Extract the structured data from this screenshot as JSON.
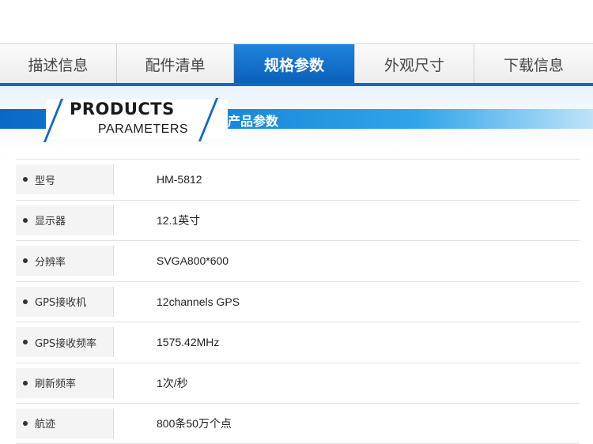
{
  "tabs": [
    {
      "label": "描述信息",
      "active": false
    },
    {
      "label": "配件清单",
      "active": false
    },
    {
      "label": "规格参数",
      "active": true
    },
    {
      "label": "外观尺寸",
      "active": false
    },
    {
      "label": "下载信息",
      "active": false
    }
  ],
  "header": {
    "title_en_line1": "PRODUCTS",
    "title_en_line2": "PARAMETERS",
    "title_cn": "产品参数"
  },
  "specs": [
    {
      "label": "型号",
      "value": "HM-5812"
    },
    {
      "label": "显示器",
      "value": "12.1英寸"
    },
    {
      "label": "分辨率",
      "value": "SVGA800*600"
    },
    {
      "label": "GPS接收机",
      "value": "12channels GPS"
    },
    {
      "label": "GPS接收频率",
      "value": "1575.42MHz"
    },
    {
      "label": "刷新频率",
      "value": "1次/秒"
    },
    {
      "label": "航迹",
      "value": "800条50万个点"
    }
  ],
  "colors": {
    "accent": "#1467c2",
    "active_tab": "#0c5fb8"
  }
}
